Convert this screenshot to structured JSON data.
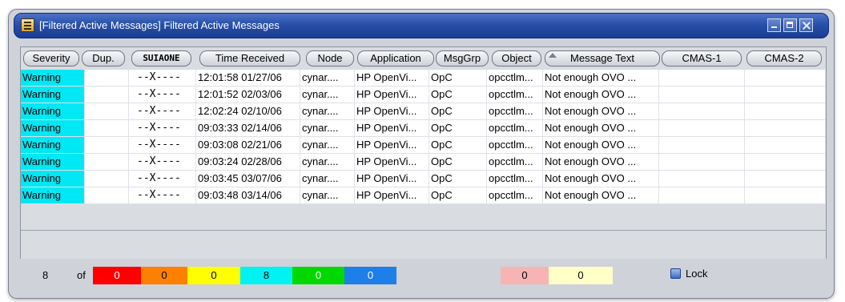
{
  "window": {
    "title": "[Filtered Active Messages] Filtered Active Messages",
    "controls": [
      "minimize-icon",
      "maximize-icon",
      "close-icon"
    ]
  },
  "table": {
    "columns": [
      "Severity",
      "Dup.",
      "SUIAONE",
      "Time Received",
      "Node",
      "Application",
      "MsgGrp",
      "Object",
      "Message Text",
      "CMAS-1",
      "CMAS-2"
    ],
    "sorted_column_icon": "sort-up-icon",
    "rows": [
      {
        "severity": "Warning",
        "dup": "",
        "suiaone": "--X----",
        "time": "12:01:58 01/27/06",
        "node": "cynar....",
        "application": "HP OpenVi...",
        "msggrp": "OpC",
        "object": "opcctlm...",
        "text": "Not enough OVO ...",
        "cmas1": "",
        "cmas2": ""
      },
      {
        "severity": "Warning",
        "dup": "",
        "suiaone": "--X----",
        "time": "12:01:52 02/03/06",
        "node": "cynar....",
        "application": "HP OpenVi...",
        "msggrp": "OpC",
        "object": "opcctlm...",
        "text": "Not enough OVO ...",
        "cmas1": "",
        "cmas2": ""
      },
      {
        "severity": "Warning",
        "dup": "",
        "suiaone": "--X----",
        "time": "12:02:24 02/10/06",
        "node": "cynar....",
        "application": "HP OpenVi...",
        "msggrp": "OpC",
        "object": "opcctlm...",
        "text": "Not enough OVO ...",
        "cmas1": "",
        "cmas2": ""
      },
      {
        "severity": "Warning",
        "dup": "",
        "suiaone": "--X----",
        "time": "09:03:33 02/14/06",
        "node": "cynar....",
        "application": "HP OpenVi...",
        "msggrp": "OpC",
        "object": "opcctlm...",
        "text": "Not enough OVO ...",
        "cmas1": "",
        "cmas2": ""
      },
      {
        "severity": "Warning",
        "dup": "",
        "suiaone": "--X----",
        "time": "09:03:08 02/21/06",
        "node": "cynar....",
        "application": "HP OpenVi...",
        "msggrp": "OpC",
        "object": "opcctlm...",
        "text": "Not enough OVO ...",
        "cmas1": "",
        "cmas2": ""
      },
      {
        "severity": "Warning",
        "dup": "",
        "suiaone": "--X----",
        "time": "09:03:24 02/28/06",
        "node": "cynar....",
        "application": "HP OpenVi...",
        "msggrp": "OpC",
        "object": "opcctlm...",
        "text": "Not enough OVO ...",
        "cmas1": "",
        "cmas2": ""
      },
      {
        "severity": "Warning",
        "dup": "",
        "suiaone": "--X----",
        "time": "09:03:45 03/07/06",
        "node": "cynar....",
        "application": "HP OpenVi...",
        "msggrp": "OpC",
        "object": "opcctlm...",
        "text": "Not enough OVO ...",
        "cmas1": "",
        "cmas2": ""
      },
      {
        "severity": "Warning",
        "dup": "",
        "suiaone": "--X----",
        "time": "09:03:48 03/14/06",
        "node": "cynar....",
        "application": "HP OpenVi...",
        "msggrp": "OpC",
        "object": "opcctlm...",
        "text": "Not enough OVO ...",
        "cmas1": "",
        "cmas2": ""
      }
    ],
    "severity_color": "#00e8f4"
  },
  "status": {
    "count": "8",
    "of_label": "of",
    "severity_counts": [
      {
        "name": "critical",
        "value": "0",
        "color": "#ff0000",
        "text_color": "#ffffff"
      },
      {
        "name": "major",
        "value": "0",
        "color": "#ff8000",
        "text_color": "#000000"
      },
      {
        "name": "minor",
        "value": "0",
        "color": "#ffff00",
        "text_color": "#000000"
      },
      {
        "name": "warning",
        "value": "8",
        "color": "#00f2f2",
        "text_color": "#000000"
      },
      {
        "name": "normal",
        "value": "0",
        "color": "#00d800",
        "text_color": "#ffffff"
      },
      {
        "name": "unknown",
        "value": "0",
        "color": "#1f7fe8",
        "text_color": "#ffffff"
      }
    ],
    "extra_counts": [
      {
        "name": "unbuffered",
        "value": "0",
        "color": "#f8b4b4"
      },
      {
        "name": "buffered",
        "value": "0",
        "color": "#ffffc8"
      }
    ],
    "lock_label": "Lock",
    "lock_icon": "lock-checkbox-icon"
  }
}
